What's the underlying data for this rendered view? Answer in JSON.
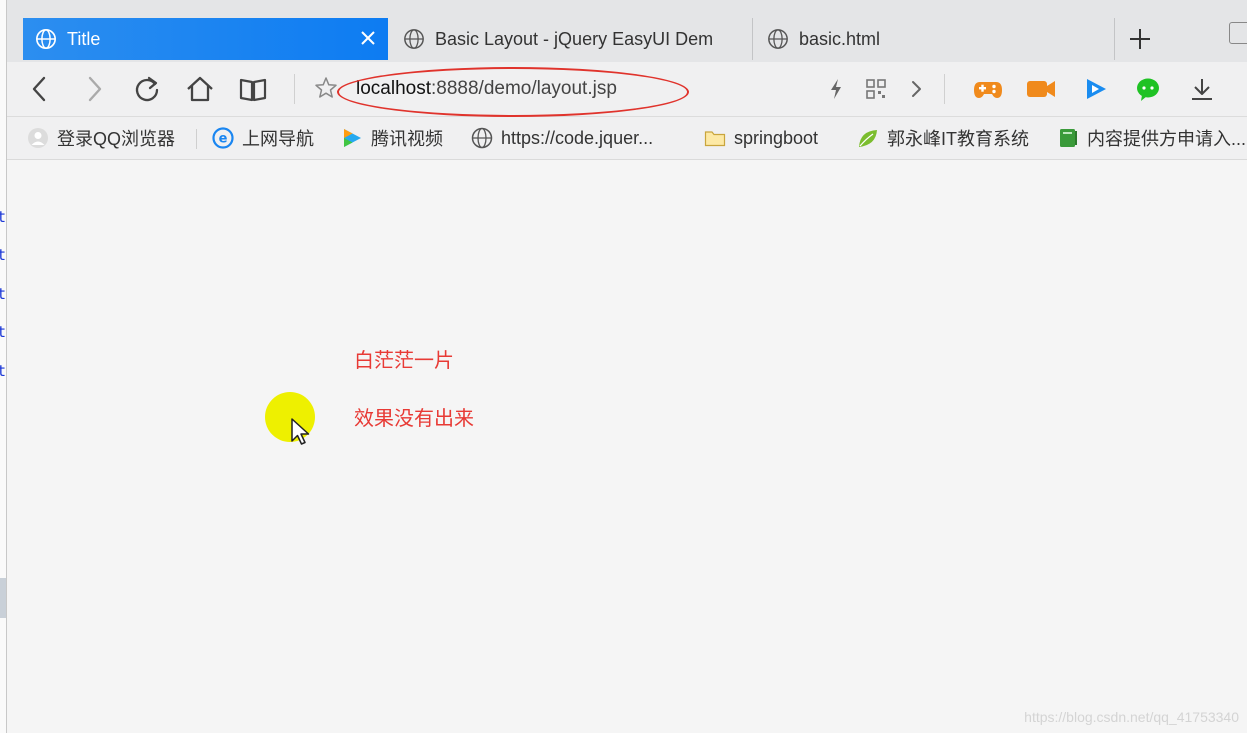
{
  "browser": {
    "tabs": [
      {
        "title": "Title",
        "active": true
      },
      {
        "title": "Basic Layout - jQuery EasyUI Dem",
        "active": false
      },
      {
        "title": "basic.html",
        "active": false
      }
    ],
    "address_host": "localhost",
    "address_rest": ":8888/demo/layout.jsp",
    "accent_color": "#1a86f1",
    "highlight_color": "#e0332c"
  },
  "bookmarks": [
    {
      "label": "登录QQ浏览器",
      "icon": "user-avatar-icon"
    },
    {
      "label": "上网导航",
      "icon": "ie-e-icon"
    },
    {
      "label": "腾讯视频",
      "icon": "play-icon"
    },
    {
      "label": "https://code.jquer...",
      "icon": "globe-icon"
    },
    {
      "label": "springboot",
      "icon": "folder-icon"
    },
    {
      "label": "郭永峰IT教育系统",
      "icon": "leaf-icon"
    },
    {
      "label": "内容提供方申请入...",
      "icon": "book-icon"
    }
  ],
  "content": {
    "notes": [
      "白茫茫一片",
      "效果没有出来"
    ],
    "note_color": "#e83a35"
  },
  "watermark": "https://blog.csdn.net/qq_41753340"
}
